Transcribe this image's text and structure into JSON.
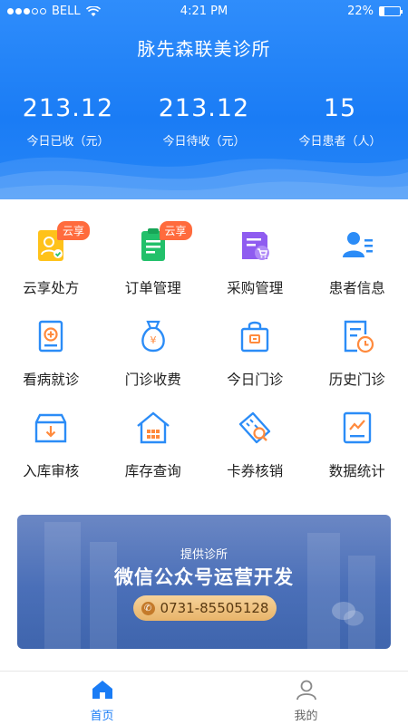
{
  "status_bar": {
    "carrier": "BELL",
    "time": "4:21 PM",
    "battery": "22%",
    "battery_level": 0.22
  },
  "app_title": "脉先森联美诊所",
  "stats": [
    {
      "value": "213.12",
      "label": "今日已收（元）"
    },
    {
      "value": "213.12",
      "label": "今日待收（元）"
    },
    {
      "value": "15",
      "label": "今日患者（人）"
    }
  ],
  "grid": [
    {
      "label": "云享处方",
      "icon": "cloud-prescription-icon",
      "badge": "云享"
    },
    {
      "label": "订单管理",
      "icon": "order-clipboard-icon",
      "badge": "云享"
    },
    {
      "label": "采购管理",
      "icon": "purchase-cart-icon"
    },
    {
      "label": "患者信息",
      "icon": "patient-info-icon"
    },
    {
      "label": "看病就诊",
      "icon": "medical-visit-icon"
    },
    {
      "label": "门诊收费",
      "icon": "money-bag-icon"
    },
    {
      "label": "今日门诊",
      "icon": "today-clinic-bag-icon"
    },
    {
      "label": "历史门诊",
      "icon": "history-clock-icon"
    },
    {
      "label": "入库审核",
      "icon": "inbox-arrow-icon"
    },
    {
      "label": "库存查询",
      "icon": "warehouse-icon"
    },
    {
      "label": "卡券核销",
      "icon": "coupon-search-icon"
    },
    {
      "label": "数据统计",
      "icon": "chart-document-icon"
    }
  ],
  "banner": {
    "subtitle": "提供诊所",
    "title": "微信公众号运营开发",
    "phone": "0731-85505128"
  },
  "tabbar": [
    {
      "label": "首页",
      "icon": "home-icon",
      "active": true
    },
    {
      "label": "我的",
      "icon": "user-icon",
      "active": false
    }
  ],
  "colors": {
    "primary": "#1a7cf5",
    "badge": "#ff6b3d"
  }
}
